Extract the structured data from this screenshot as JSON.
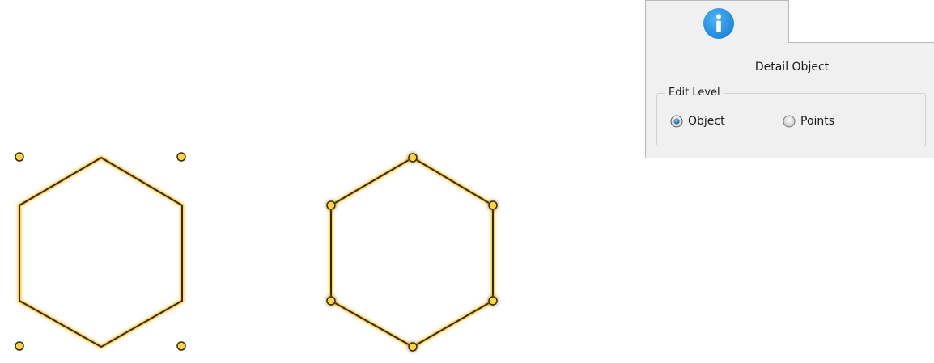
{
  "panel": {
    "tab_icon": "info-icon",
    "title": "Detail Object",
    "edit_level": {
      "legend": "Edit Level",
      "options": [
        {
          "label": "Object",
          "selected": true
        },
        {
          "label": "Points",
          "selected": false
        }
      ]
    }
  },
  "colors": {
    "shape_stroke": "#3a2a00",
    "glow": "#f7c12f",
    "handle_fill": "#ffd24a",
    "info_blue": "#2196e8"
  }
}
